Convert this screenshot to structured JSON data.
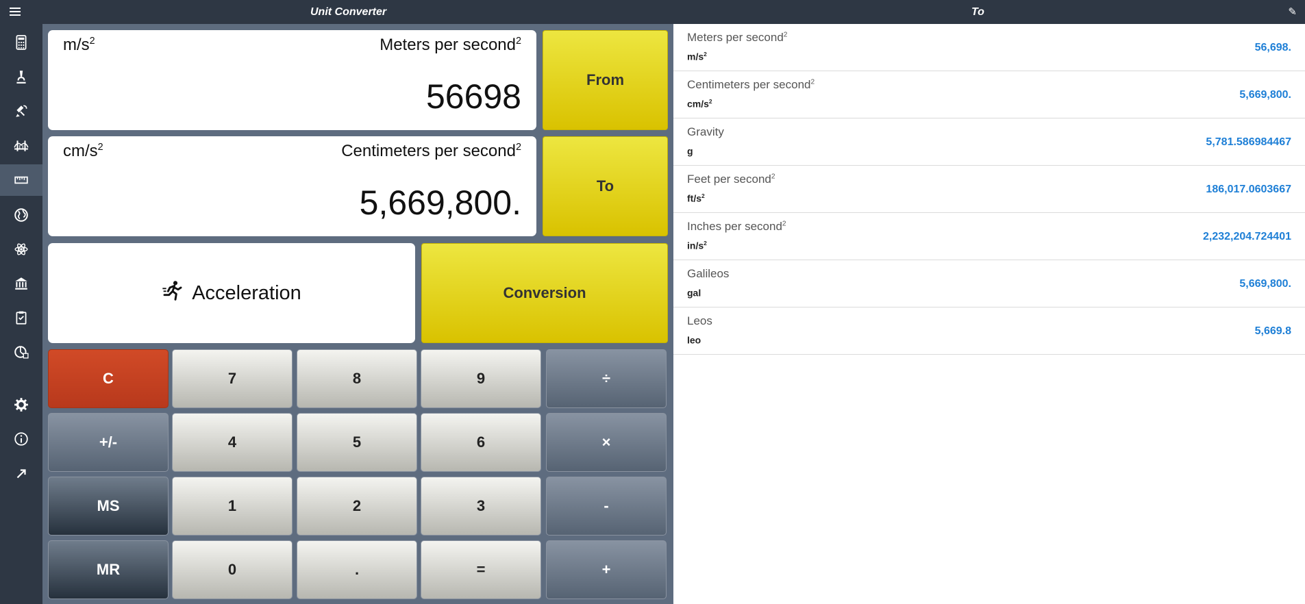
{
  "titlebar": {
    "app_title": "Unit Converter",
    "right_title": "To",
    "menu_icon": "hamburger-menu-icon",
    "pen_icon": "pen-icon"
  },
  "sidebar": {
    "items": [
      {
        "icon": "calculator-icon",
        "active": false
      },
      {
        "icon": "microscope-icon",
        "active": false
      },
      {
        "icon": "satellite-icon",
        "active": false
      },
      {
        "icon": "bridge-icon",
        "active": false
      },
      {
        "icon": "ruler-icon",
        "active": true
      },
      {
        "icon": "globe-icon",
        "active": false
      },
      {
        "icon": "atom-icon",
        "active": false
      },
      {
        "icon": "bank-icon",
        "active": false
      },
      {
        "icon": "clipboard-icon",
        "active": false
      },
      {
        "icon": "chart-icon",
        "active": false
      },
      {
        "icon": "gear-icon",
        "active": false
      },
      {
        "icon": "info-icon",
        "active": false
      },
      {
        "icon": "arrow-icon",
        "active": false
      }
    ]
  },
  "from_card": {
    "abbr_base": "m/s",
    "abbr_sup": "2",
    "full_base": "Meters per second",
    "full_sup": "2",
    "value": "56698"
  },
  "to_card": {
    "abbr_base": "cm/s",
    "abbr_sup": "2",
    "full_base": "Centimeters per second",
    "full_sup": "2",
    "value": "5,669,800."
  },
  "buttons": {
    "from": "From",
    "to": "To",
    "conversion": "Conversion",
    "category": "Acceleration",
    "category_icon": "runner-icon"
  },
  "keypad": {
    "clear": "C",
    "k7": "7",
    "k8": "8",
    "k9": "9",
    "divide": "÷",
    "negate": "+/-",
    "k4": "4",
    "k5": "5",
    "k6": "6",
    "multiply": "×",
    "ms": "MS",
    "k1": "1",
    "k2": "2",
    "k3": "3",
    "minus": "-",
    "mr": "MR",
    "k0": "0",
    "dot": ".",
    "equals": "=",
    "plus": "+"
  },
  "results": [
    {
      "name": "Meters per second",
      "sup": "2",
      "abbr": "m/s",
      "abbr_sup": "2",
      "value": "56,698."
    },
    {
      "name": "Centimeters per second",
      "sup": "2",
      "abbr": "cm/s",
      "abbr_sup": "2",
      "value": "5,669,800."
    },
    {
      "name": "Gravity",
      "sup": "",
      "abbr": "g",
      "abbr_sup": "",
      "value": "5,781.586984467"
    },
    {
      "name": "Feet per second",
      "sup": "2",
      "abbr": "ft/s",
      "abbr_sup": "2",
      "value": "186,017.0603667"
    },
    {
      "name": "Inches per second",
      "sup": "2",
      "abbr": "in/s",
      "abbr_sup": "2",
      "value": "2,232,204.724401"
    },
    {
      "name": "Galileos",
      "sup": "",
      "abbr": "gal",
      "abbr_sup": "",
      "value": "5,669,800."
    },
    {
      "name": "Leos",
      "sup": "",
      "abbr": "leo",
      "abbr_sup": "",
      "value": "5,669.8"
    }
  ],
  "colors": {
    "accent_yellow": "#e5d82a",
    "clear_red": "#c94323",
    "value_blue": "#1e7fd6",
    "sidebar_bg": "#2e3744"
  }
}
